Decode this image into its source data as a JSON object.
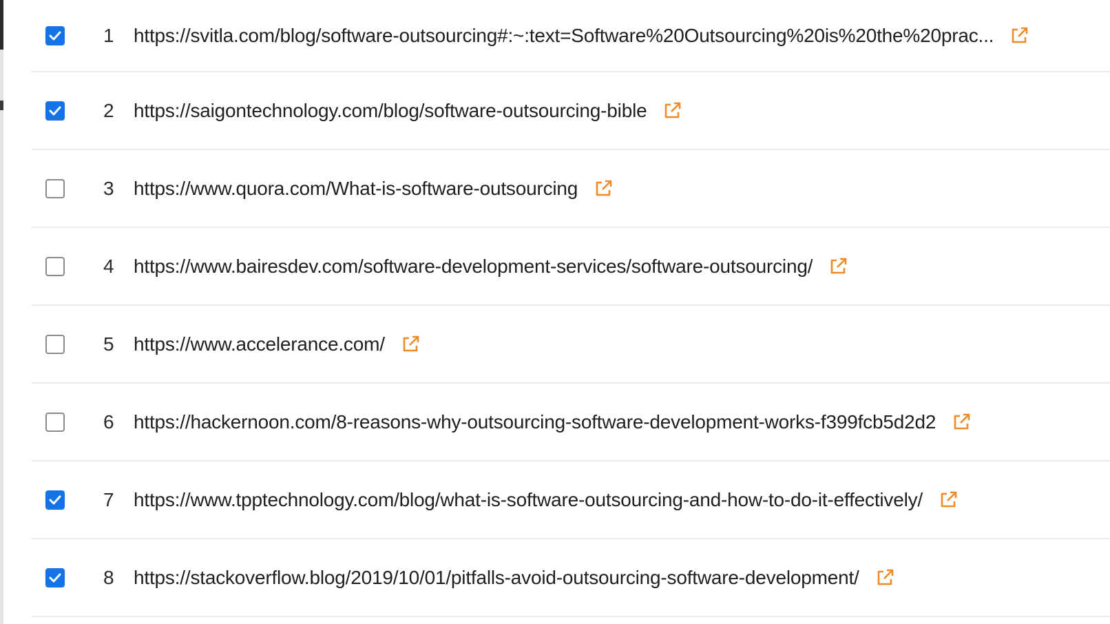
{
  "colors": {
    "checkbox_checked": "#1473e6",
    "external_link_icon": "#f08a24",
    "row_divider": "#ececec",
    "text": "#1f1f1f"
  },
  "rows": [
    {
      "index": "1",
      "checked": true,
      "url": "https://svitla.com/blog/software-outsourcing#:~:text=Software%20Outsourcing%20is%20the%20prac...",
      "icon": "external-link-icon"
    },
    {
      "index": "2",
      "checked": true,
      "url": "https://saigontechnology.com/blog/software-outsourcing-bible",
      "icon": "external-link-icon"
    },
    {
      "index": "3",
      "checked": false,
      "url": "https://www.quora.com/What-is-software-outsourcing",
      "icon": "external-link-icon"
    },
    {
      "index": "4",
      "checked": false,
      "url": "https://www.bairesdev.com/software-development-services/software-outsourcing/",
      "icon": "external-link-icon"
    },
    {
      "index": "5",
      "checked": false,
      "url": "https://www.accelerance.com/",
      "icon": "external-link-icon"
    },
    {
      "index": "6",
      "checked": false,
      "url": "https://hackernoon.com/8-reasons-why-outsourcing-software-development-works-f399fcb5d2d2",
      "icon": "external-link-icon"
    },
    {
      "index": "7",
      "checked": true,
      "url": "https://www.tpptechnology.com/blog/what-is-software-outsourcing-and-how-to-do-it-effectively/",
      "icon": "external-link-icon"
    },
    {
      "index": "8",
      "checked": true,
      "url": "https://stackoverflow.blog/2019/10/01/pitfalls-avoid-outsourcing-software-development/",
      "icon": "external-link-icon"
    }
  ]
}
